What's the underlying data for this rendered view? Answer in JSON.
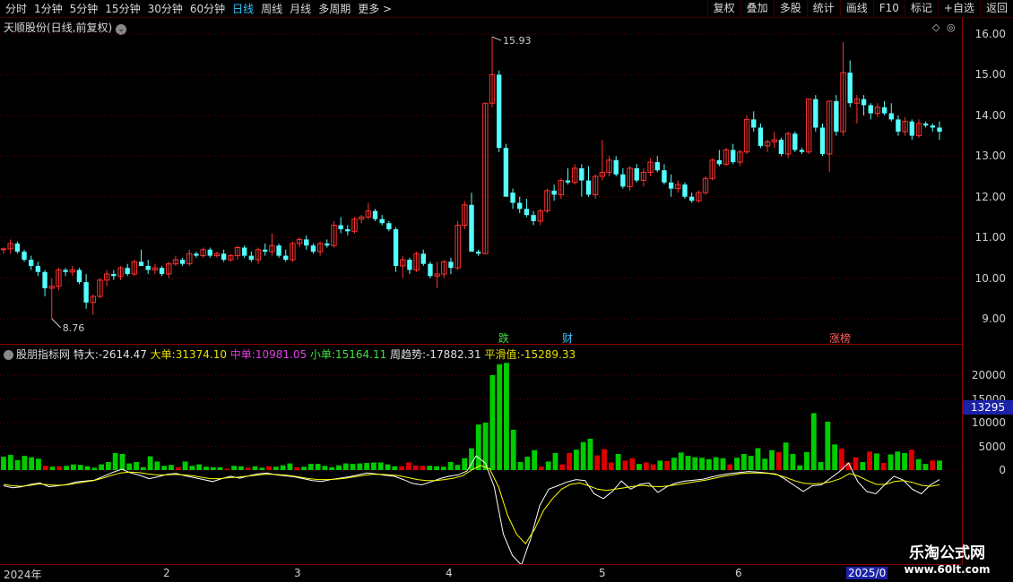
{
  "toolbar": {
    "periods": [
      "分时",
      "1分钟",
      "5分钟",
      "15分钟",
      "30分钟",
      "60分钟",
      "日线",
      "周线",
      "月线",
      "多周期",
      "更多 >"
    ],
    "active": "日线",
    "actions": [
      "复权",
      "叠加",
      "多股",
      "统计",
      "画线",
      "F10",
      "标记",
      "+自选",
      "返回"
    ]
  },
  "chart_title": "天顺股份(日线,前复权)",
  "indicator": {
    "name": "股朋指标网",
    "items": [
      {
        "label": "特大:",
        "value": "-2614.47",
        "color": "#e0e0e0"
      },
      {
        "label": "大单:",
        "value": "31374.10",
        "color": "#e8e000"
      },
      {
        "label": "中单:",
        "value": "10981.05",
        "color": "#e040e0"
      },
      {
        "label": "小单:",
        "value": "15164.11",
        "color": "#40e040"
      },
      {
        "label": "周趋势:",
        "value": "-17882.31",
        "color": "#e0e0e0"
      },
      {
        "label": "平滑值:",
        "value": "-15289.33",
        "color": "#e8e000"
      }
    ]
  },
  "price_axis": [
    "16.00",
    "15.00",
    "14.00",
    "13.00",
    "12.00",
    "11.00",
    "10.00",
    "9.00"
  ],
  "ind_axis": [
    "20000",
    "15000",
    "10000",
    "5000",
    "0"
  ],
  "ind_highlight": "13295",
  "events": [
    {
      "text": "跌",
      "color": "#40e040"
    },
    {
      "text": "财",
      "color": "#39c6ff"
    },
    {
      "text": "涨榜",
      "color": "#ff6060"
    }
  ],
  "price_labels": {
    "high": "15.93",
    "low": "8.76"
  },
  "date_axis": [
    "2024年",
    "2",
    "3",
    "4",
    "5",
    "6",
    "2025/0"
  ],
  "watermark": {
    "line1": "乐淘公式网",
    "line2": "www.60lt.com"
  },
  "chart_data": [
    {
      "type": "candlestick",
      "title": "天顺股份(日线,前复权)",
      "y_range": [
        8.6,
        16.2
      ],
      "candles": [
        [
          10.7,
          10.75,
          10.6,
          10.72
        ],
        [
          10.72,
          10.95,
          10.6,
          10.85
        ],
        [
          10.85,
          10.9,
          10.6,
          10.65
        ],
        [
          10.65,
          10.7,
          10.4,
          10.45
        ],
        [
          10.45,
          10.55,
          10.2,
          10.3
        ],
        [
          10.3,
          10.4,
          10.05,
          10.15
        ],
        [
          10.15,
          10.2,
          9.55,
          9.75
        ],
        [
          9.75,
          10.0,
          9.0,
          9.8
        ],
        [
          9.8,
          10.25,
          9.7,
          10.2
        ],
        [
          10.2,
          10.25,
          10.05,
          10.15
        ],
        [
          10.15,
          10.3,
          10.05,
          10.2
        ],
        [
          10.2,
          10.25,
          9.85,
          9.9
        ],
        [
          9.9,
          10.1,
          9.25,
          9.4
        ],
        [
          9.4,
          9.6,
          9.1,
          9.55
        ],
        [
          9.55,
          10.0,
          9.5,
          9.95
        ],
        [
          9.95,
          10.2,
          9.8,
          10.1
        ],
        [
          10.1,
          10.2,
          9.95,
          10.05
        ],
        [
          10.05,
          10.3,
          9.95,
          10.25
        ],
        [
          10.25,
          10.35,
          10.05,
          10.1
        ],
        [
          10.1,
          10.45,
          10.05,
          10.4
        ],
        [
          10.4,
          10.7,
          10.3,
          10.3
        ],
        [
          10.3,
          10.45,
          10.1,
          10.2
        ],
        [
          10.2,
          10.35,
          10.1,
          10.25
        ],
        [
          10.25,
          10.3,
          10.05,
          10.1
        ],
        [
          10.1,
          10.4,
          10.0,
          10.35
        ],
        [
          10.35,
          10.55,
          10.3,
          10.45
        ],
        [
          10.45,
          10.5,
          10.3,
          10.35
        ],
        [
          10.35,
          10.7,
          10.3,
          10.6
        ],
        [
          10.6,
          10.65,
          10.5,
          10.55
        ],
        [
          10.55,
          10.75,
          10.5,
          10.7
        ],
        [
          10.7,
          10.75,
          10.5,
          10.55
        ],
        [
          10.55,
          10.65,
          10.5,
          10.6
        ],
        [
          10.6,
          10.7,
          10.4,
          10.45
        ],
        [
          10.45,
          10.6,
          10.4,
          10.55
        ],
        [
          10.55,
          10.8,
          10.45,
          10.75
        ],
        [
          10.75,
          10.8,
          10.5,
          10.55
        ],
        [
          10.55,
          10.65,
          10.4,
          10.45
        ],
        [
          10.45,
          10.75,
          10.35,
          10.7
        ],
        [
          10.7,
          10.85,
          10.55,
          10.65
        ],
        [
          10.65,
          11.1,
          10.55,
          10.8
        ],
        [
          10.8,
          10.85,
          10.5,
          10.55
        ],
        [
          10.55,
          10.7,
          10.4,
          10.45
        ],
        [
          10.45,
          10.9,
          10.4,
          10.85
        ],
        [
          10.85,
          11.0,
          10.75,
          10.95
        ],
        [
          10.95,
          11.05,
          10.7,
          10.8
        ],
        [
          10.8,
          10.85,
          10.6,
          10.65
        ],
        [
          10.65,
          10.9,
          10.55,
          10.85
        ],
        [
          10.85,
          10.95,
          10.75,
          10.8
        ],
        [
          10.8,
          11.4,
          10.75,
          11.3
        ],
        [
          11.3,
          11.5,
          11.1,
          11.2
        ],
        [
          11.2,
          11.3,
          11.05,
          11.15
        ],
        [
          11.15,
          11.5,
          11.1,
          11.45
        ],
        [
          11.45,
          11.55,
          11.35,
          11.5
        ],
        [
          11.5,
          11.85,
          11.45,
          11.65
        ],
        [
          11.65,
          11.7,
          11.4,
          11.45
        ],
        [
          11.45,
          11.55,
          11.3,
          11.35
        ],
        [
          11.35,
          11.4,
          11.15,
          11.2
        ],
        [
          11.2,
          11.25,
          10.15,
          10.3
        ],
        [
          10.3,
          10.55,
          10.0,
          10.45
        ],
        [
          10.45,
          10.5,
          10.1,
          10.2
        ],
        [
          10.2,
          10.65,
          10.15,
          10.6
        ],
        [
          10.6,
          10.7,
          10.3,
          10.35
        ],
        [
          10.35,
          10.4,
          10.0,
          10.05
        ],
        [
          10.05,
          10.4,
          9.75,
          10.1
        ],
        [
          10.1,
          10.45,
          10.0,
          10.4
        ],
        [
          10.4,
          10.5,
          10.1,
          10.25
        ],
        [
          10.25,
          11.4,
          10.2,
          11.3
        ],
        [
          11.3,
          11.9,
          11.2,
          11.8
        ],
        [
          11.8,
          12.1,
          10.65,
          10.65
        ],
        [
          10.65,
          10.7,
          10.55,
          10.6
        ],
        [
          10.6,
          14.3,
          10.6,
          14.3
        ],
        [
          14.3,
          15.93,
          14.2,
          15.0
        ],
        [
          15.0,
          15.1,
          13.1,
          13.2
        ],
        [
          13.2,
          13.3,
          12.5,
          12.0
        ],
        [
          12.1,
          12.2,
          11.7,
          11.85
        ],
        [
          11.85,
          12.0,
          11.6,
          11.7
        ],
        [
          11.7,
          11.95,
          11.5,
          11.55
        ],
        [
          11.55,
          11.65,
          11.3,
          11.4
        ],
        [
          11.4,
          11.7,
          11.3,
          11.65
        ],
        [
          11.65,
          12.2,
          11.6,
          12.15
        ],
        [
          12.15,
          12.3,
          11.9,
          12.05
        ],
        [
          12.05,
          12.45,
          11.95,
          12.4
        ],
        [
          12.4,
          12.7,
          12.3,
          12.35
        ],
        [
          12.35,
          12.8,
          12.3,
          12.7
        ],
        [
          12.7,
          12.8,
          12.0,
          12.4
        ],
        [
          12.4,
          12.75,
          12.0,
          12.05
        ],
        [
          12.05,
          12.55,
          11.95,
          12.5
        ],
        [
          12.5,
          13.4,
          12.4,
          12.6
        ],
        [
          12.6,
          13.0,
          12.5,
          12.9
        ],
        [
          12.9,
          13.0,
          12.5,
          12.55
        ],
        [
          12.55,
          12.7,
          12.2,
          12.25
        ],
        [
          12.25,
          12.75,
          12.15,
          12.7
        ],
        [
          12.7,
          12.8,
          12.35,
          12.4
        ],
        [
          12.4,
          12.7,
          12.25,
          12.6
        ],
        [
          12.6,
          12.95,
          12.5,
          12.85
        ],
        [
          12.85,
          13.0,
          12.6,
          12.65
        ],
        [
          12.65,
          12.8,
          12.3,
          12.35
        ],
        [
          12.35,
          12.55,
          12.0,
          12.2
        ],
        [
          12.2,
          12.4,
          12.1,
          12.3
        ],
        [
          12.3,
          12.35,
          11.95,
          12.0
        ],
        [
          12.0,
          12.1,
          11.85,
          11.9
        ],
        [
          11.9,
          12.15,
          11.85,
          12.1
        ],
        [
          12.1,
          12.5,
          12.05,
          12.45
        ],
        [
          12.45,
          12.95,
          12.4,
          12.9
        ],
        [
          12.9,
          13.15,
          12.75,
          12.8
        ],
        [
          12.8,
          13.2,
          12.75,
          13.15
        ],
        [
          13.15,
          13.3,
          12.8,
          12.85
        ],
        [
          12.85,
          13.15,
          12.75,
          13.1
        ],
        [
          13.1,
          14.0,
          13.05,
          13.9
        ],
        [
          13.9,
          14.1,
          13.6,
          13.7
        ],
        [
          13.7,
          13.8,
          13.2,
          13.25
        ],
        [
          13.25,
          13.4,
          13.1,
          13.35
        ],
        [
          13.35,
          13.6,
          13.2,
          13.4
        ],
        [
          13.4,
          13.45,
          13.0,
          13.05
        ],
        [
          13.05,
          13.6,
          12.95,
          13.55
        ],
        [
          13.55,
          13.6,
          13.1,
          13.15
        ],
        [
          13.15,
          13.2,
          13.05,
          13.1
        ],
        [
          13.1,
          14.4,
          13.05,
          14.4
        ],
        [
          14.4,
          14.5,
          13.6,
          13.7
        ],
        [
          13.7,
          13.8,
          13.0,
          13.05
        ],
        [
          13.05,
          14.35,
          12.6,
          14.35
        ],
        [
          14.35,
          14.5,
          13.5,
          13.6
        ],
        [
          13.6,
          15.8,
          13.5,
          15.05
        ],
        [
          15.05,
          15.35,
          14.2,
          14.3
        ],
        [
          14.3,
          14.5,
          13.8,
          14.4
        ],
        [
          14.4,
          14.5,
          14.0,
          14.25
        ],
        [
          14.25,
          14.3,
          13.9,
          14.05
        ],
        [
          14.05,
          14.3,
          13.95,
          14.2
        ],
        [
          14.2,
          14.35,
          14.0,
          14.05
        ],
        [
          14.05,
          14.3,
          13.85,
          13.9
        ],
        [
          13.9,
          14.0,
          13.5,
          13.6
        ],
        [
          13.6,
          13.95,
          13.5,
          13.85
        ],
        [
          13.85,
          13.9,
          13.4,
          13.5
        ],
        [
          13.5,
          13.9,
          13.45,
          13.8
        ],
        [
          13.8,
          13.85,
          13.7,
          13.75
        ],
        [
          13.75,
          13.8,
          13.6,
          13.7
        ],
        [
          13.7,
          13.85,
          13.4,
          13.6
        ]
      ],
      "annotations": [
        "15.93",
        "8.76"
      ]
    },
    {
      "type": "bar",
      "title": "股朋指标网",
      "y_range": [
        -18000,
        22000
      ],
      "values": [
        2800,
        3200,
        2100,
        3000,
        2700,
        2400,
        -900,
        700,
        -800,
        900,
        1200,
        1100,
        800,
        500,
        1200,
        1700,
        3600,
        3400,
        1400,
        1700,
        600,
        2900,
        1800,
        900,
        1100,
        -600,
        1800,
        900,
        1200,
        700,
        600,
        600,
        -300,
        900,
        800,
        -500,
        800,
        500,
        -800,
        700,
        1000,
        1400,
        -600,
        700,
        1300,
        1300,
        900,
        600,
        1000,
        1400,
        1300,
        1400,
        1500,
        1600,
        1600,
        1200,
        800,
        -800,
        -1600,
        -1000,
        -900,
        900,
        800,
        700,
        1700,
        1100,
        2500,
        4600,
        9600,
        10000,
        20000,
        22300,
        22600,
        8500,
        1700,
        2800,
        4200,
        -700,
        1800,
        3600,
        -1200,
        -3600,
        4300,
        5900,
        6600,
        -3100,
        -4400,
        -1600,
        3400,
        -2000,
        -2500,
        1300,
        -1600,
        -1200,
        2000,
        -1900,
        2600,
        3700,
        3000,
        2700,
        2600,
        2300,
        2700,
        2500,
        -1200,
        2600,
        3400,
        3000,
        4600,
        2400,
        4200,
        -3800,
        5800,
        3400,
        1000,
        3800,
        12000,
        1700,
        10200,
        5400,
        -4500,
        -1600,
        -2700,
        1700,
        -3900,
        3500,
        -1500,
        3300,
        3900,
        3600,
        -4300,
        2300,
        1300,
        -2000,
        2000
      ],
      "series": [
        {
          "name": "周趋势",
          "values": [
            -1800,
            -2200,
            -2000,
            -1500,
            -1200,
            -2000,
            -1800,
            -1500,
            -1000,
            -800,
            -600,
            200,
            1000,
            1700,
            900,
            400,
            -300,
            100,
            600,
            800,
            300,
            -100,
            -500,
            -900,
            -300,
            200,
            -200,
            300,
            700,
            900,
            500,
            300,
            100,
            -300,
            -700,
            -900,
            -500,
            -200,
            100,
            500,
            900,
            700,
            400,
            200,
            -500,
            -1300,
            -1600,
            -1000,
            -300,
            200,
            500,
            1300,
            4500,
            3000,
            -2000,
            -12000,
            -16500,
            -18500,
            -13000,
            -6000,
            -2500,
            -1800,
            -1000,
            -500,
            -700,
            -3500,
            -4500,
            -3000,
            -800,
            -2500,
            -1500,
            -1200,
            -3200,
            -2000,
            -1200,
            -800,
            -600,
            -400,
            100,
            500,
            800,
            1000,
            1200,
            1100,
            900,
            700,
            -400,
            -1700,
            -3000,
            -1800,
            -1600,
            -200,
            1200,
            3000,
            -900,
            -3000,
            -3500,
            -1500,
            200,
            -600,
            -2500,
            -3500,
            -1600,
            -500
          ]
        },
        {
          "name": "平滑值",
          "values": [
            -1500,
            -1800,
            -1900,
            -1700,
            -1400,
            -1600,
            -1700,
            -1600,
            -1300,
            -1000,
            -700,
            -200,
            400,
            900,
            1100,
            1000,
            700,
            500,
            500,
            600,
            500,
            300,
            0,
            -300,
            -300,
            -100,
            0,
            200,
            400,
            600,
            600,
            500,
            300,
            0,
            -300,
            -500,
            -500,
            -400,
            -200,
            100,
            400,
            600,
            600,
            500,
            300,
            -100,
            -500,
            -700,
            -700,
            -500,
            -200,
            300,
            1500,
            2500,
            1800,
            -2000,
            -8000,
            -12000,
            -14000,
            -11000,
            -7000,
            -4500,
            -2500,
            -1500,
            -1200,
            -1800,
            -2500,
            -2800,
            -2500,
            -2200,
            -1900,
            -1700,
            -1900,
            -2000,
            -1800,
            -1500,
            -1200,
            -900,
            -600,
            -200,
            200,
            500,
            800,
            900,
            900,
            800,
            500,
            -100,
            -800,
            -1300,
            -1400,
            -1300,
            -900,
            -300,
            800,
            200,
            -700,
            -1500,
            -1500,
            -900,
            -700,
            -1100,
            -1700,
            -1900,
            -1600
          ]
        }
      ]
    }
  ]
}
